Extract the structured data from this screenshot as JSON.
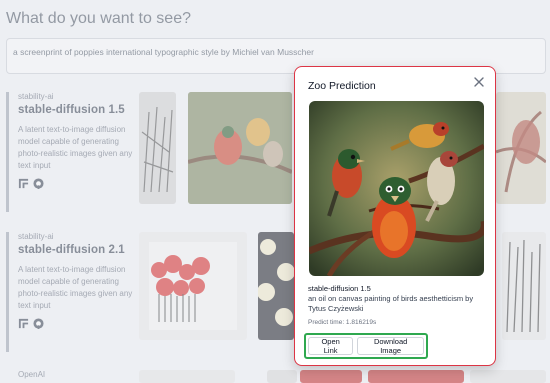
{
  "page": {
    "heading": "What do you want to see?",
    "prompt_value": "a screenprint of poppies international typographic style by Michiel van Musscher"
  },
  "models": [
    {
      "org": "stability-ai",
      "name": "stable-diffusion 1.5",
      "description": "A latent text-to-image diffusion model capable of generating photo-realistic images given any text input"
    },
    {
      "org": "stability-ai",
      "name": "stable-diffusion 2.1",
      "description": "A latent text-to-image diffusion model capable of generating photo-realistic images given any text input"
    },
    {
      "org": "OpenAI",
      "name": "",
      "description": ""
    }
  ],
  "modal": {
    "title": "Zoo Prediction",
    "model_name": "stable-diffusion 1.5",
    "caption": "an oil on canvas painting of birds aesthetticism by Tytus Czyżewski",
    "predict_time": "Predict time: 1.816219s",
    "open_link_label": "Open Link",
    "download_label": "Download Image"
  },
  "colors": {
    "modal_border": "#dc3545",
    "button_group_highlight": "#2fa84f"
  },
  "icons": {
    "close": "close-icon",
    "paper": "paper-icon",
    "github": "github-icon"
  }
}
